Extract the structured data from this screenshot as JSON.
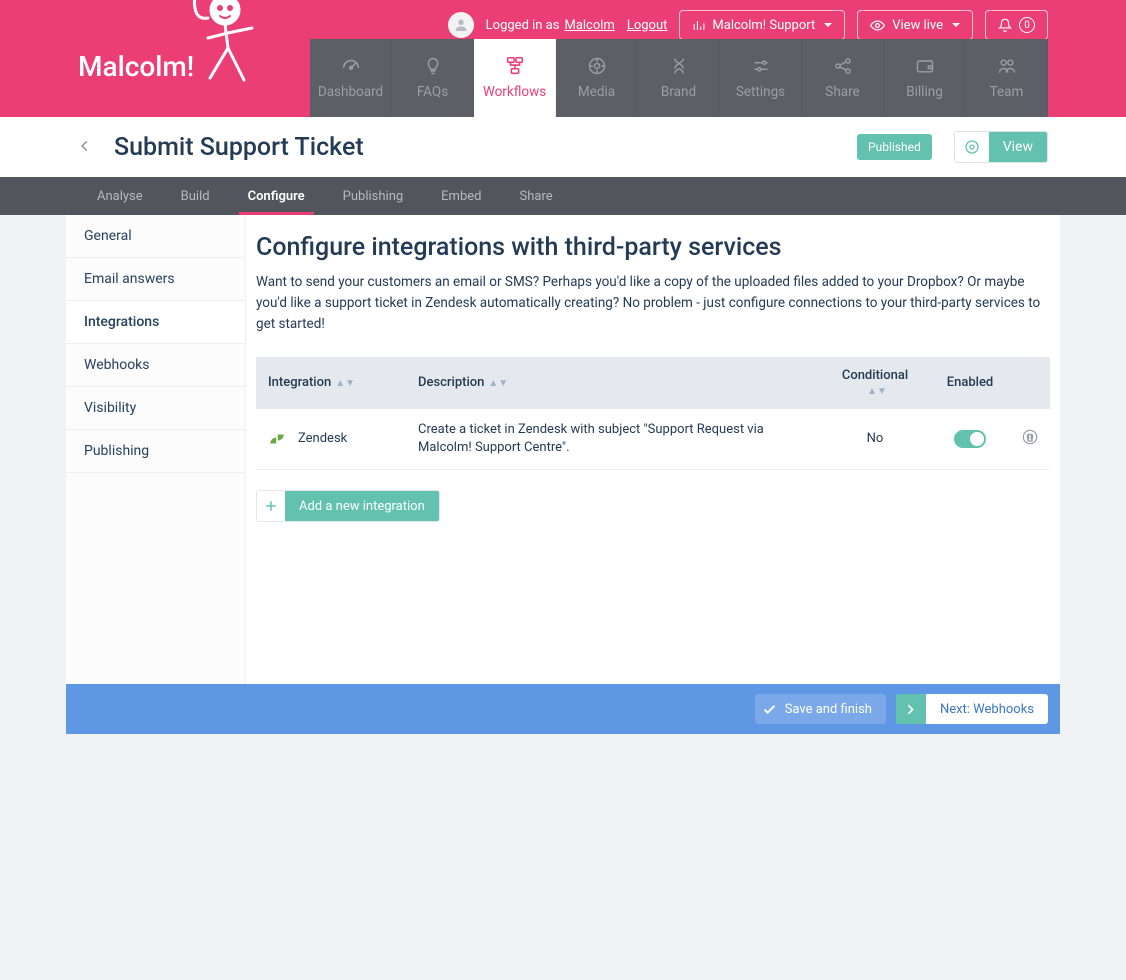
{
  "brand": "Malcolm!",
  "header": {
    "logged_in_as_prefix": "Logged in as",
    "username": "Malcolm",
    "logout": "Logout",
    "support_btn": "Malcolm! Support",
    "view_live": "View live",
    "notif_count": "0"
  },
  "nav": {
    "dashboard": "Dashboard",
    "faqs": "FAQs",
    "workflows": "Workflows",
    "media": "Media",
    "brand": "Brand",
    "settings": "Settings",
    "share": "Share",
    "billing": "Billing",
    "team": "Team"
  },
  "page": {
    "title": "Submit Support Ticket",
    "status": "Published",
    "view": "View"
  },
  "subnav": {
    "analyse": "Analyse",
    "build": "Build",
    "configure": "Configure",
    "publishing": "Publishing",
    "embed": "Embed",
    "share": "Share"
  },
  "sidebar": {
    "general": "General",
    "email": "Email answers",
    "integrations": "Integrations",
    "webhooks": "Webhooks",
    "visibility": "Visibility",
    "publishing": "Publishing"
  },
  "section": {
    "title": "Configure integrations with third-party services",
    "description": "Want to send your customers an email or SMS? Perhaps you'd like a copy of the uploaded files added to your Dropbox? Or maybe you'd like a support ticket in Zendesk automatically creating? No problem - just configure connections to your third-party services to get started!"
  },
  "table": {
    "cols": {
      "integration": "Integration",
      "description": "Description",
      "conditional": "Conditional",
      "enabled": "Enabled"
    },
    "rows": [
      {
        "name": "Zendesk",
        "description": "Create a ticket in Zendesk with subject \"Support Request via Malcolm! Support Centre\".",
        "conditional": "No",
        "enabled": true
      }
    ]
  },
  "add_btn": "Add a new integration",
  "footer": {
    "save": "Save and finish",
    "next": "Next: Webhooks"
  }
}
